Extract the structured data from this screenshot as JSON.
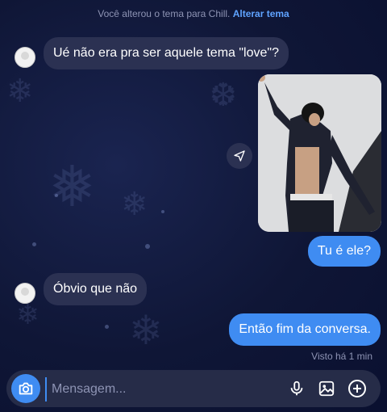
{
  "system": {
    "text": "Você alterou o tema para Chill.",
    "link": "Alterar tema"
  },
  "messages": [
    {
      "side": "in",
      "text": "Ué não era pra ser aquele tema \"love\"?"
    },
    {
      "side": "out",
      "type": "photo"
    },
    {
      "side": "out",
      "text": "Tu é ele?"
    },
    {
      "side": "in",
      "text": "Óbvio que não"
    },
    {
      "side": "out",
      "text": "Então fim da conversa."
    }
  ],
  "seen": "Visto há 1 min",
  "composer": {
    "placeholder": "Mensagem..."
  },
  "colors": {
    "accent": "#3f8cf2",
    "incoming_bubble": "#2b3152",
    "background": "#0f1636"
  },
  "icons": [
    "camera-icon",
    "microphone-icon",
    "gallery-icon",
    "add-icon",
    "share-icon"
  ]
}
